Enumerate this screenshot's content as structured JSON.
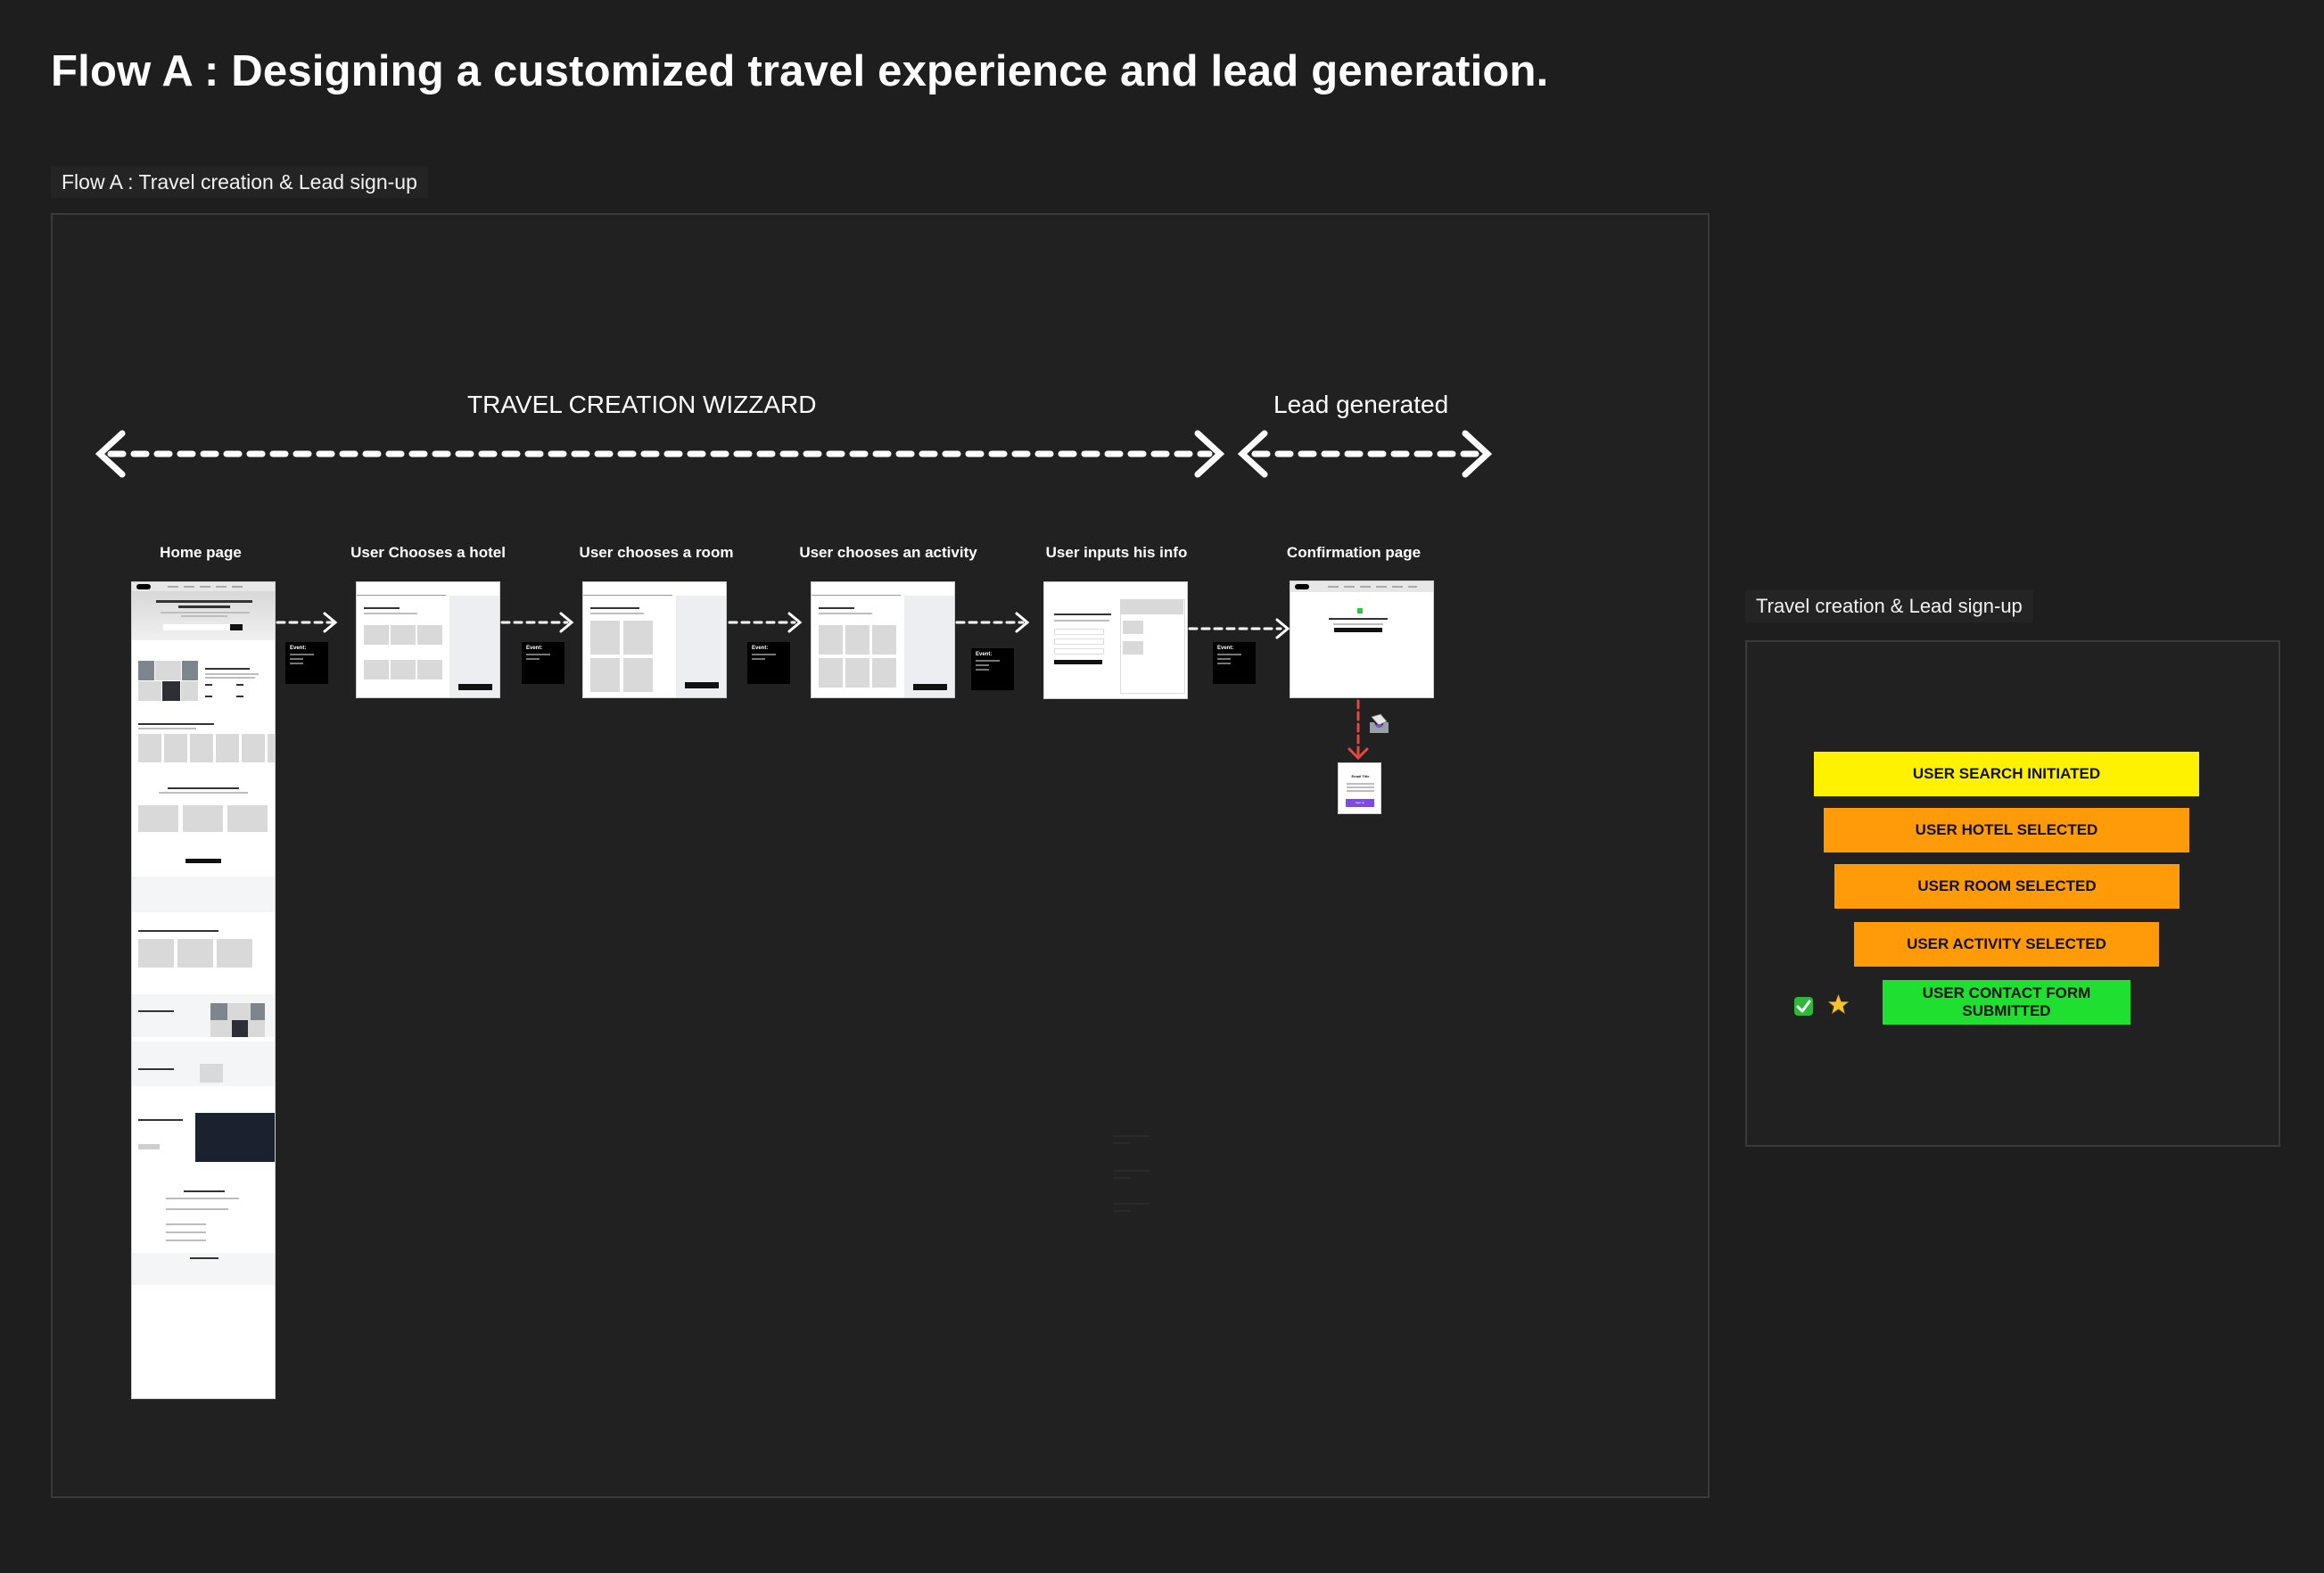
{
  "page": {
    "title": "Flow A : Designing a customized travel experience and lead generation."
  },
  "main_frame": {
    "label": "Flow A : Travel creation & Lead sign-up",
    "sections": {
      "wizard": "TRAVEL CREATION WIZZARD",
      "lead": "Lead generated"
    },
    "steps": [
      {
        "label": "Home page"
      },
      {
        "label": "User Chooses a hotel"
      },
      {
        "label": "User chooses a room"
      },
      {
        "label": "User chooses an activity"
      },
      {
        "label": "User inputs his info"
      },
      {
        "label": "Confirmation page"
      }
    ],
    "event_boxes": [
      {
        "title": "Event:"
      },
      {
        "title": "Event:"
      },
      {
        "title": "Event:"
      },
      {
        "title": "Event:"
      },
      {
        "title": "Event:"
      }
    ],
    "email": {
      "title": "Email Title",
      "cta": "Sign up"
    },
    "arrow_colors": {
      "flow": "#ffffff",
      "email": "#e5483f"
    }
  },
  "side_frame": {
    "label": "Travel creation & Lead sign-up",
    "funnel": [
      {
        "label": "USER SEARCH INITIATED",
        "color": "#fff200"
      },
      {
        "label": "USER HOTEL SELECTED",
        "color": "#ff9a08"
      },
      {
        "label": "USER ROOM SELECTED",
        "color": "#ff9a08"
      },
      {
        "label": "USER ACTIVITY SELECTED",
        "color": "#ff9a08"
      },
      {
        "label": "USER CONTACT FORM SUBMITTED",
        "color": "#1fe030"
      }
    ],
    "markers": {
      "check": "check-mark-icon",
      "star": "star-icon"
    }
  }
}
